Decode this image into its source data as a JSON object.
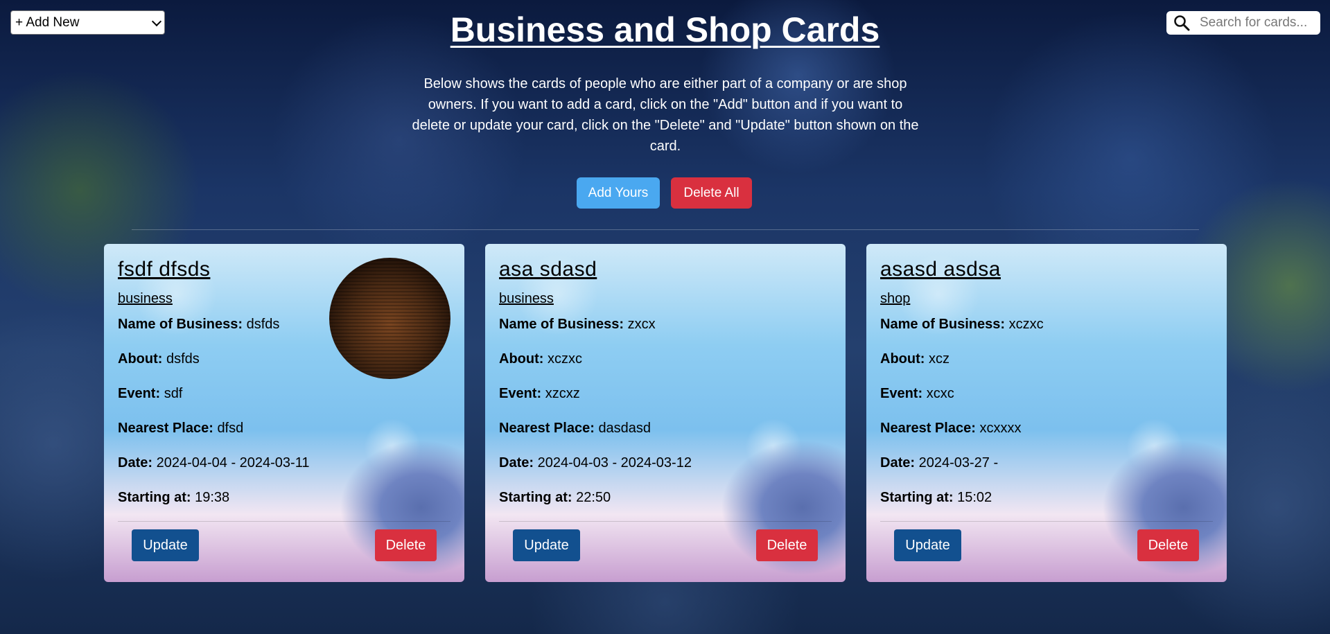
{
  "toolbar": {
    "add_new_selected": "+ Add New"
  },
  "search": {
    "placeholder": "Search for cards..."
  },
  "header": {
    "title": "Business and Shop Cards",
    "description": "Below shows the cards of people who are either part of a company or are shop owners. If you want to add a card, click on the \"Add\" button and if you want to delete or update your card, click on the \"Delete\" and \"Update\" button shown on the card.",
    "add_yours_label": "Add Yours",
    "delete_all_label": "Delete All"
  },
  "labels": {
    "business_name": "Name of Business:",
    "about": "About:",
    "event": "Event:",
    "nearest_place": "Nearest Place:",
    "date": "Date:",
    "starting_at": "Starting at:",
    "update": "Update",
    "delete": "Delete"
  },
  "cards": [
    {
      "name": "fsdf dfsds",
      "type": "business",
      "business_name": "dsfds",
      "about": "dsfds",
      "event": "sdf",
      "nearest_place": "dfsd",
      "date": "2024-04-04 - 2024-03-11",
      "starting_at": "19:38"
    },
    {
      "name": "asa sdasd",
      "type": "business",
      "business_name": "zxcx",
      "about": "xczxc",
      "event": "xzcxz",
      "nearest_place": "dasdasd",
      "date": "2024-04-03 - 2024-03-12",
      "starting_at": "22:50"
    },
    {
      "name": "asasd asdsa",
      "type": "shop",
      "business_name": "xczxc",
      "about": "xcz",
      "event": "xcxc",
      "nearest_place": "xcxxxx",
      "date": "2024-03-27 -",
      "starting_at": "15:02"
    }
  ],
  "colors": {
    "update_button": "#12508f",
    "delete_button": "#d9303f",
    "add_yours_button": "#4aa8f0"
  }
}
